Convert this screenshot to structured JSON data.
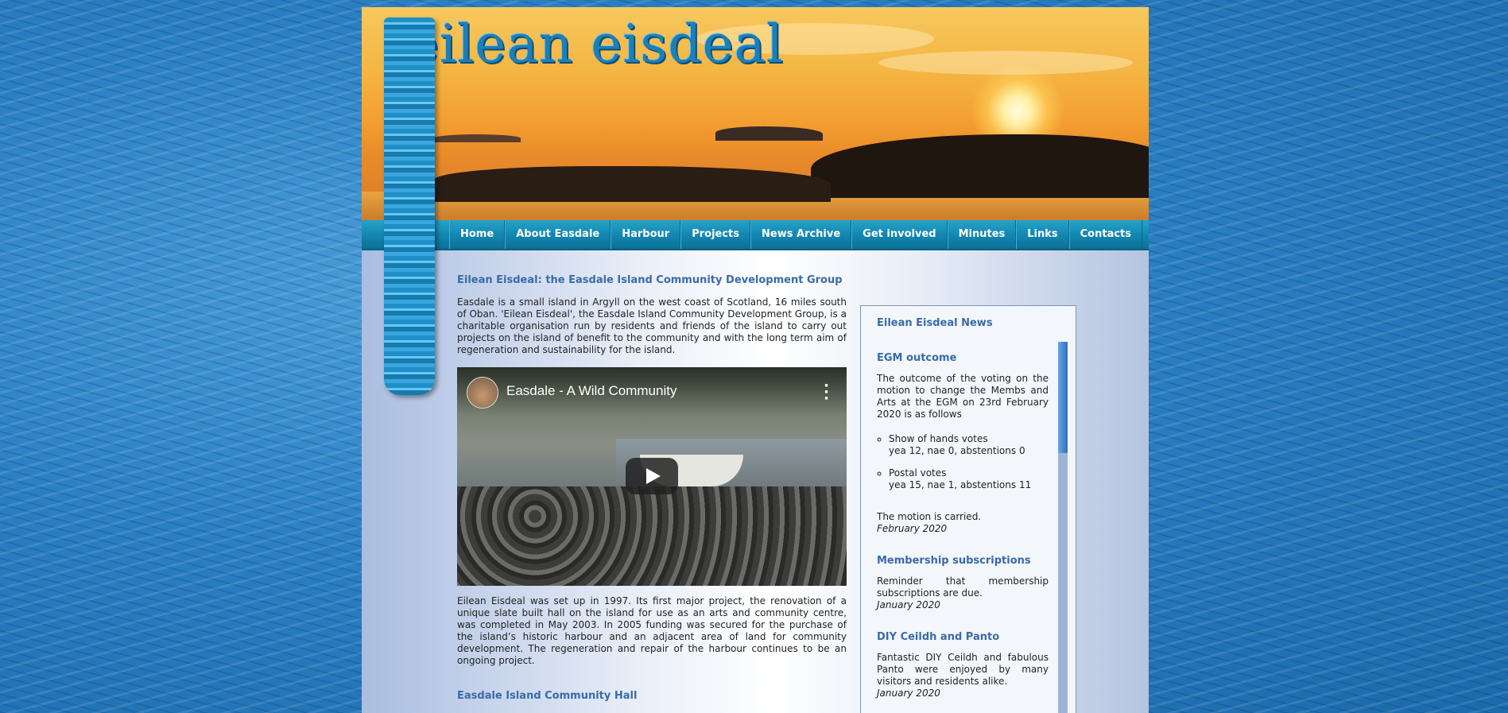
{
  "banner": {
    "logo_text": "eilean eisdeal"
  },
  "nav": {
    "items": [
      {
        "label": "Home"
      },
      {
        "label": "About Easdale"
      },
      {
        "label": "Harbour"
      },
      {
        "label": "Projects"
      },
      {
        "label": "News Archive"
      },
      {
        "label": "Get involved"
      },
      {
        "label": "Minutes"
      },
      {
        "label": "Links"
      },
      {
        "label": "Contacts"
      }
    ]
  },
  "main": {
    "title": "Eilean Eisdeal: the Easdale Island Community Development Group",
    "intro": "Easdale is a small island in Argyll on the west coast of Scotland, 16 miles south of Oban. 'Eilean Eisdeal', the Easdale Island Community Development Group, is a charitable organisation run by residents and friends of the island to carry out projects on the island of benefit to the community and with the long term aim of regeneration and sustainability for the island.",
    "video": {
      "title": "Easdale - A Wild Community",
      "play_icon": "play-icon",
      "menu_icon": "more-vertical-icon"
    },
    "para2": "Eilean Eisdeal was set up in 1997. Its first major project, the renovation of a unique slate built hall on the island for use as an arts and community centre, was completed in May 2003. In 2005 funding was secured for the purchase of the island’s historic harbour and an adjacent area of land for community development. The regeneration and repair of the harbour continues to be an ongoing project.",
    "hall_title": "Easdale Island Community Hall"
  },
  "news": {
    "heading": "Eilean Eisdeal News",
    "items": [
      {
        "title": "EGM outcome",
        "text": "The outcome of the voting on the motion to change the Membs and Arts at the EGM on 23rd February 2020 is as follows",
        "votes": [
          {
            "label": "Show of hands votes",
            "result": "yea 12, nae 0, abstentions 0"
          },
          {
            "label": "Postal votes",
            "result": "yea 15, nae 1, abstentions 11"
          }
        ],
        "conclusion": "The motion is carried.",
        "date": "February 2020"
      },
      {
        "title": "Membership subscriptions",
        "text": "Reminder that membership subscriptions are due.",
        "date": "January 2020"
      },
      {
        "title": "DIY Ceildh and Panto",
        "text": "Fantastic DIY Ceildh and fabulous Panto were enjoyed by many visitors and residents alike.",
        "date": "January 2020"
      }
    ]
  }
}
